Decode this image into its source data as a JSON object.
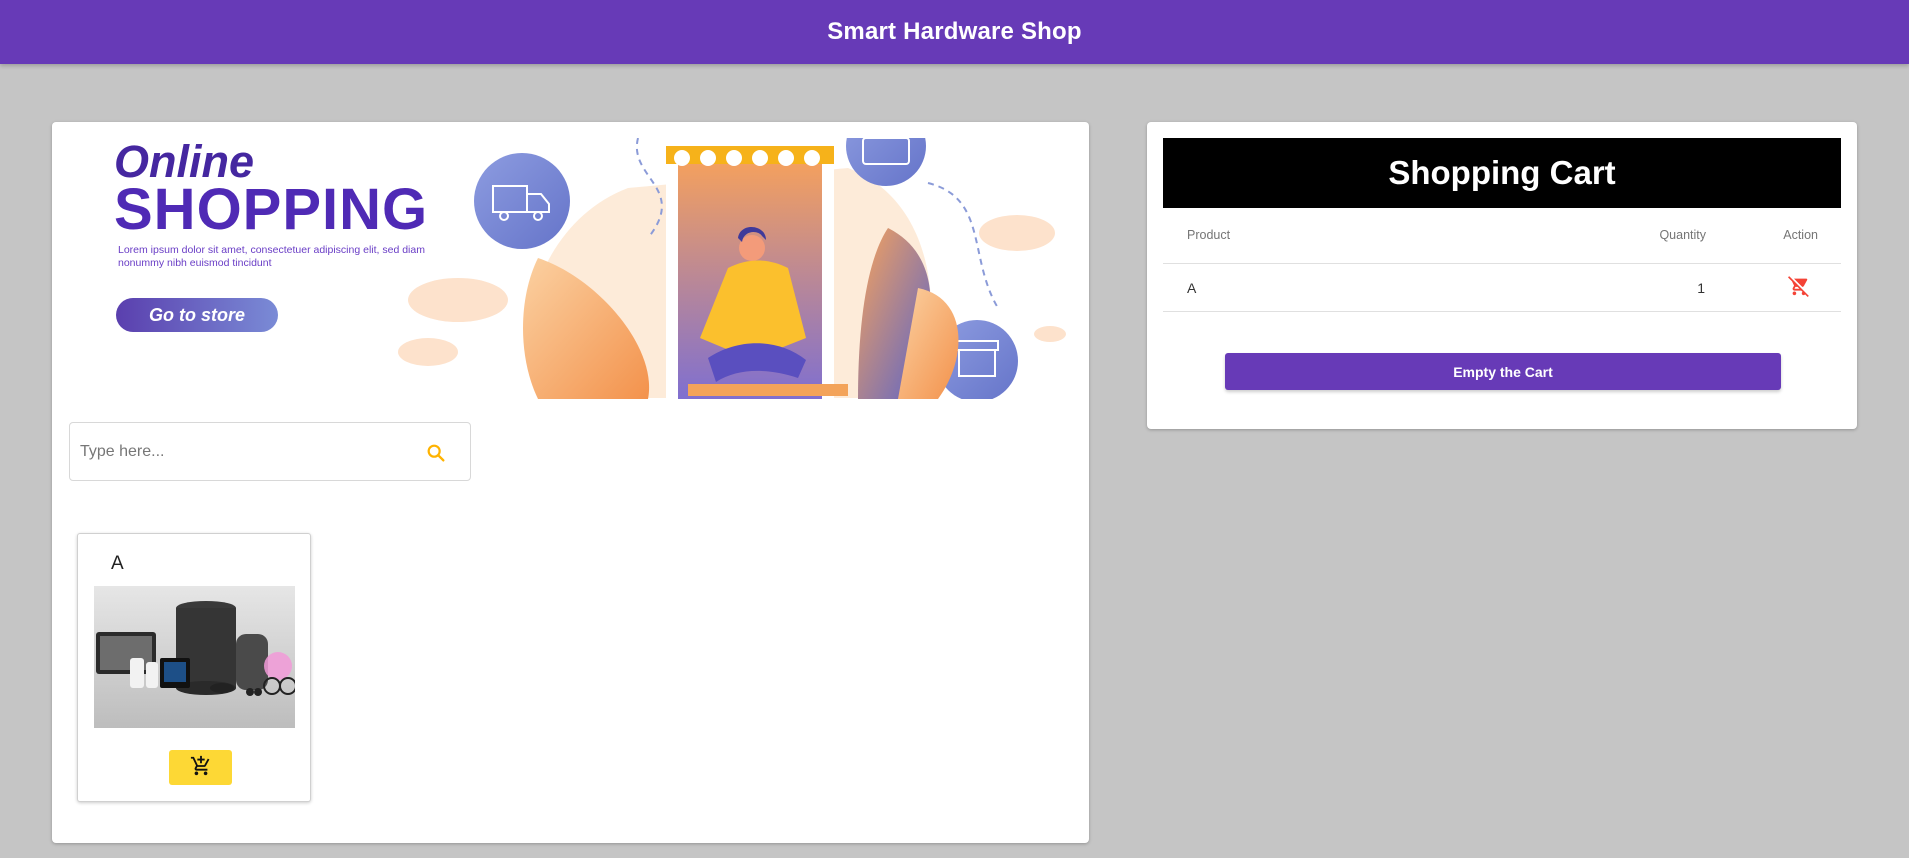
{
  "app": {
    "title": "Smart Hardware Shop"
  },
  "banner": {
    "title_line1": "Online",
    "title_line2": "SHOPPING",
    "text": "Lorem ipsum dolor sit amet, consectetuer adipiscing elit, sed diam nonummy nibh euismod tincidunt",
    "button_label": "Go to store"
  },
  "search": {
    "placeholder": "Type here..."
  },
  "products": [
    {
      "name": "A",
      "add_icon": "add-shopping-cart-icon"
    }
  ],
  "cart": {
    "title": "Shopping Cart",
    "columns": {
      "product": "Product",
      "quantity": "Quantity",
      "action": "Action"
    },
    "rows": [
      {
        "product": "A",
        "quantity": "1",
        "action_icon": "remove-shopping-cart-icon"
      }
    ],
    "empty_button": "Empty the Cart"
  },
  "colors": {
    "primary": "#673ab7",
    "accent": "#fdd835",
    "warn": "#f44336",
    "background": "#c5c5c5"
  }
}
